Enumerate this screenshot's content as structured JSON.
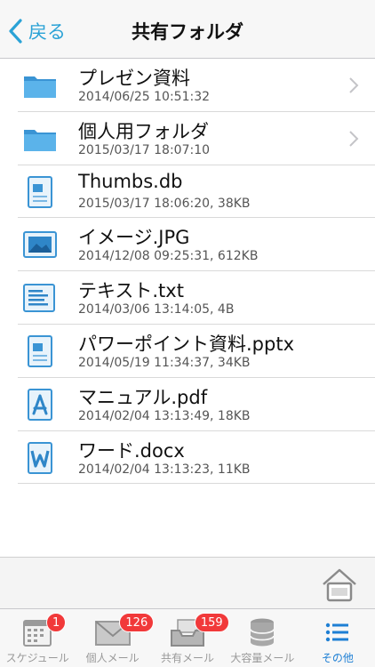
{
  "nav": {
    "back_label": "戻る",
    "title": "共有フォルダ"
  },
  "items": [
    {
      "name": "プレゼン資料",
      "meta": "2014/06/25 10:51:32",
      "icon": "folder-icon"
    },
    {
      "name": "個人用フォルダ",
      "meta": "2015/03/17 18:07:10",
      "icon": "folder-icon"
    },
    {
      "name": "Thumbs.db",
      "meta": "2015/03/17 18:06:20, 38KB",
      "icon": "generic-file-icon"
    },
    {
      "name": "イメージ.JPG",
      "meta": "2014/12/08 09:25:31, 612KB",
      "icon": "image-file-icon"
    },
    {
      "name": "テキスト.txt",
      "meta": "2014/03/06 13:14:05, 4B",
      "icon": "text-file-icon"
    },
    {
      "name": "パワーポイント資料.pptx",
      "meta": "2014/05/19 11:34:37, 34KB",
      "icon": "generic-file-icon"
    },
    {
      "name": "マニュアル.pdf",
      "meta": "2014/02/04 13:13:49, 18KB",
      "icon": "pdf-file-icon"
    },
    {
      "name": "ワード.docx",
      "meta": "2014/02/04 13:13:23, 11KB",
      "icon": "word-file-icon"
    }
  ],
  "tabs": [
    {
      "label": "スケジュール",
      "badge": "1",
      "icon": "calendar-icon"
    },
    {
      "label": "個人メール",
      "badge": "126",
      "icon": "envelope-icon"
    },
    {
      "label": "共有メール",
      "badge": "159",
      "icon": "inbox-tray-icon"
    },
    {
      "label": "大容量メール",
      "badge": "",
      "icon": "database-icon"
    },
    {
      "label": "その他",
      "badge": "",
      "icon": "list-icon"
    }
  ],
  "colors": {
    "accent": "#2aa2d6",
    "active_tab": "#1e7fd4",
    "badge": "#f1393a",
    "folder": "#4aa6e0"
  }
}
